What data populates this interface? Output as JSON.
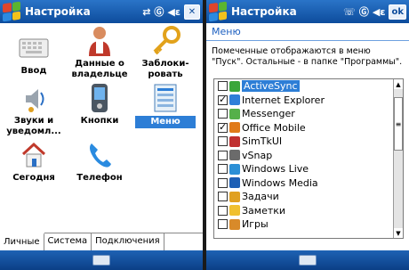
{
  "left": {
    "title": "Настройка",
    "status": {
      "sync": "⇄",
      "signal": "Ⓖ",
      "volume": "◀ε",
      "close": "✕"
    },
    "icons": [
      {
        "label": "Ввод",
        "icon": "keyboard-icon"
      },
      {
        "label": "Данные о владельце",
        "icon": "owner-info-icon"
      },
      {
        "label": "Заблоки-ровать",
        "icon": "lock-key-icon"
      },
      {
        "label": "Звуки и уведомл...",
        "icon": "sounds-icon"
      },
      {
        "label": "Кнопки",
        "icon": "buttons-icon"
      },
      {
        "label": "Меню",
        "icon": "menu-icon"
      },
      {
        "label": "Сегодня",
        "icon": "today-icon"
      },
      {
        "label": "Телефон",
        "icon": "phone-icon"
      }
    ],
    "tabs": [
      "Личные",
      "Система",
      "Подключения"
    ]
  },
  "right": {
    "title": "Настройка",
    "ok_label": "ok",
    "heading": "Меню",
    "description": "Помеченные отображаются в меню \"Пуск\". Остальные - в папке \"Программы\".",
    "items": [
      {
        "label": "ActiveSync",
        "checked": false,
        "icon": "activesync-icon",
        "color": "#3aa63a"
      },
      {
        "label": "Internet Explorer",
        "checked": true,
        "icon": "ie-icon",
        "color": "#2f7fd8"
      },
      {
        "label": "Messenger",
        "checked": false,
        "icon": "messenger-icon",
        "color": "#55b04a"
      },
      {
        "label": "Office Mobile",
        "checked": true,
        "icon": "office-icon",
        "color": "#e07a1a"
      },
      {
        "label": "SimTkUI",
        "checked": false,
        "icon": "sim-icon",
        "color": "#c03030"
      },
      {
        "label": "vSnap",
        "checked": false,
        "icon": "vsnap-icon",
        "color": "#6b6b6b"
      },
      {
        "label": "Windows Live",
        "checked": false,
        "icon": "windows-live-icon",
        "color": "#2b8fd6"
      },
      {
        "label": "Windows Media",
        "checked": false,
        "icon": "windows-media-icon",
        "color": "#1d5fb5"
      },
      {
        "label": "Задачи",
        "checked": false,
        "icon": "tasks-icon",
        "color": "#e0a020"
      },
      {
        "label": "Заметки",
        "checked": false,
        "icon": "notes-icon",
        "color": "#f0c030"
      },
      {
        "label": "Игры",
        "checked": false,
        "icon": "games-icon",
        "color": "#d88a2a"
      }
    ]
  }
}
